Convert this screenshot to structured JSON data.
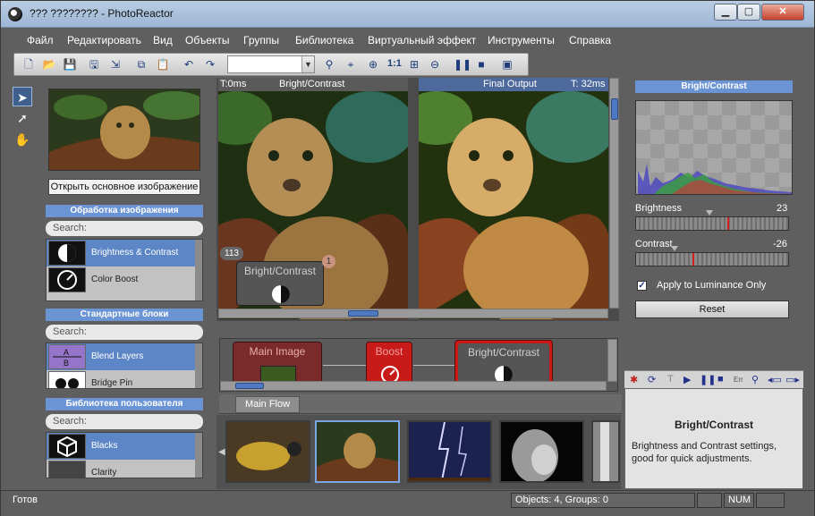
{
  "window": {
    "title": "??? ???????? - PhotoReactor",
    "min_label": "▁",
    "max_label": "▢",
    "close_label": "✕"
  },
  "menu": [
    "Файл",
    "Редактировать",
    "Вид",
    "Объекты",
    "Группы",
    "Библиотека",
    "Виртуальный эффект",
    "Инструменты",
    "Справка"
  ],
  "toolbar": {
    "zoom_label": "1:1",
    "icons": [
      "new-file-icon",
      "open-folder-icon",
      "save-icon",
      "save-as-icon",
      "export-icon",
      "copy-icon",
      "paste-icon",
      "undo-icon",
      "redo-icon",
      "zoom-combo",
      "binoculars-icon",
      "find-icon",
      "zoom-in-icon",
      "zoom-1to1",
      "fit-icon",
      "zoom-out-icon",
      "pause-icon",
      "stop-icon",
      "layout-icon"
    ]
  },
  "left_panel": {
    "open_image_button": "Открыть основное изображение",
    "sections": [
      {
        "title": "Обработка изображения",
        "search": "Search:",
        "items": [
          {
            "label": "Brightness & Contrast",
            "selected": true
          },
          {
            "label": "Color Boost",
            "selected": false
          }
        ]
      },
      {
        "title": "Стандартные блоки",
        "search": "Search:",
        "items": [
          {
            "label": "Blend Layers",
            "selected": true
          },
          {
            "label": "Bridge Pin",
            "selected": false
          }
        ]
      },
      {
        "title": "Библиотека пользователя",
        "search": "Search:",
        "items": [
          {
            "label": "Blacks",
            "selected": true
          },
          {
            "label": "Clarity",
            "selected": false
          }
        ]
      }
    ]
  },
  "views": {
    "left": {
      "time": "T:0ms",
      "title": "Bright/Contrast"
    },
    "right": {
      "title": "Final Output",
      "time": "T: 32ms"
    },
    "overlay_node": {
      "title": "Bright/Contrast",
      "count": "113",
      "badge": "1"
    }
  },
  "flow": {
    "nodes": [
      {
        "title": "Main Image",
        "color": "#8a2a2a"
      },
      {
        "title": "Boost",
        "color": "#c91a1a"
      },
      {
        "title": "Bright/Contrast",
        "color": "#c91a1a"
      }
    ],
    "tab": "Main Flow"
  },
  "right_panel": {
    "title": "Bright/Contrast",
    "brightness": {
      "label": "Brightness",
      "value": "23",
      "level": 0.6
    },
    "contrast": {
      "label": "Contrast",
      "value": "-26",
      "level": 0.37
    },
    "luminance_checkbox": "Apply to Luminance Only",
    "luminance_checked": true,
    "reset_button": "Reset"
  },
  "transport_bar": {
    "items": [
      "T",
      "▶",
      "❚❚",
      "■",
      "Err"
    ]
  },
  "description": {
    "title": "Bright/Contrast",
    "text": "Brightness and Contrast settings, good for quick adjustments."
  },
  "status_bar": {
    "ready": "Готов",
    "objects": "Objects: 4, Groups: 0",
    "num": "NUM"
  },
  "colors": {
    "accent": "#6b94d4",
    "selection": "#5d86c7",
    "node_red": "#c91a1a"
  }
}
